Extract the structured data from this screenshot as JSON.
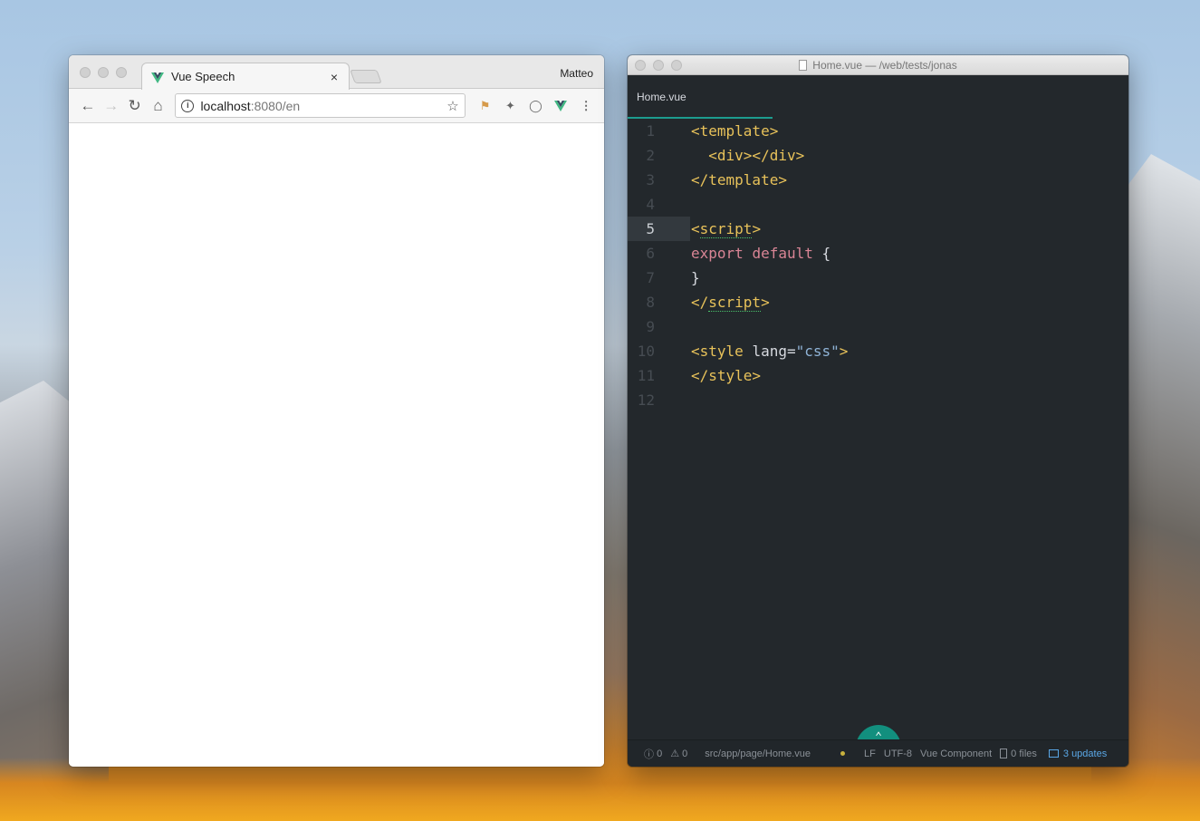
{
  "browser": {
    "tab_title": "Vue Speech",
    "tab_close": "×",
    "profile_name": "Matteo",
    "url_host": "localhost",
    "url_path": ":8080/en",
    "icons": [
      "back-icon",
      "forward-icon",
      "reload-icon",
      "home-icon",
      "info-icon",
      "star-icon",
      "extension-icon",
      "vue-devtools-icon",
      "menu-icon"
    ]
  },
  "editor": {
    "window_title": "Home.vue — /web/tests/jonas",
    "tab_label": "Home.vue",
    "current_line": "5",
    "lines": [
      {
        "n": "1",
        "html": "<span class=\"t\">&lt;template&gt;</span>"
      },
      {
        "n": "2",
        "html": "  <span class=\"t\">&lt;div&gt;&lt;/div&gt;</span>"
      },
      {
        "n": "3",
        "html": "<span class=\"t\">&lt;/template&gt;</span>"
      },
      {
        "n": "4",
        "html": ""
      },
      {
        "n": "5",
        "html": "<span class=\"t\">&lt;<span class=\"u\">script</span>&gt;</span>"
      },
      {
        "n": "6",
        "html": "<span class=\"k\">export</span> <span class=\"k\">default</span> {"
      },
      {
        "n": "7",
        "html": "}"
      },
      {
        "n": "8",
        "html": "<span class=\"t\">&lt;/<span class=\"u\">script</span>&gt;</span>"
      },
      {
        "n": "9",
        "html": ""
      },
      {
        "n": "10",
        "html": "<span class=\"t\">&lt;style</span> <span class=\"a\">lang</span>=<span class=\"s\">\"css\"</span><span class=\"t\">&gt;</span>"
      },
      {
        "n": "11",
        "html": "<span class=\"t\">&lt;/style&gt;</span>"
      },
      {
        "n": "12",
        "html": ""
      }
    ],
    "status": {
      "errors": "0",
      "warnings": "0",
      "path": "src/app/page/Home.vue",
      "line_ending": "LF",
      "encoding": "UTF-8",
      "grammar": "Vue Component",
      "files": "0 files",
      "updates": "3 updates"
    }
  }
}
